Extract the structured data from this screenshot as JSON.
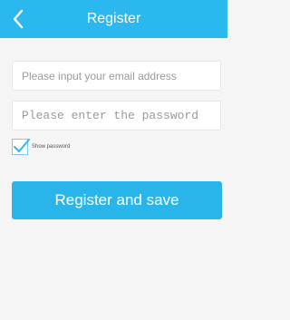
{
  "header": {
    "title": "Register",
    "back_icon": "chevron-left-icon"
  },
  "form": {
    "email_placeholder": "Please input your email address",
    "email_value": "",
    "password_placeholder": "Please enter the password",
    "password_value": "",
    "show_password_label": "Show password",
    "show_password_checked": true,
    "submit_label": "Register and save"
  },
  "colors": {
    "accent": "#2bb8ee",
    "background": "#f5f5f5"
  }
}
